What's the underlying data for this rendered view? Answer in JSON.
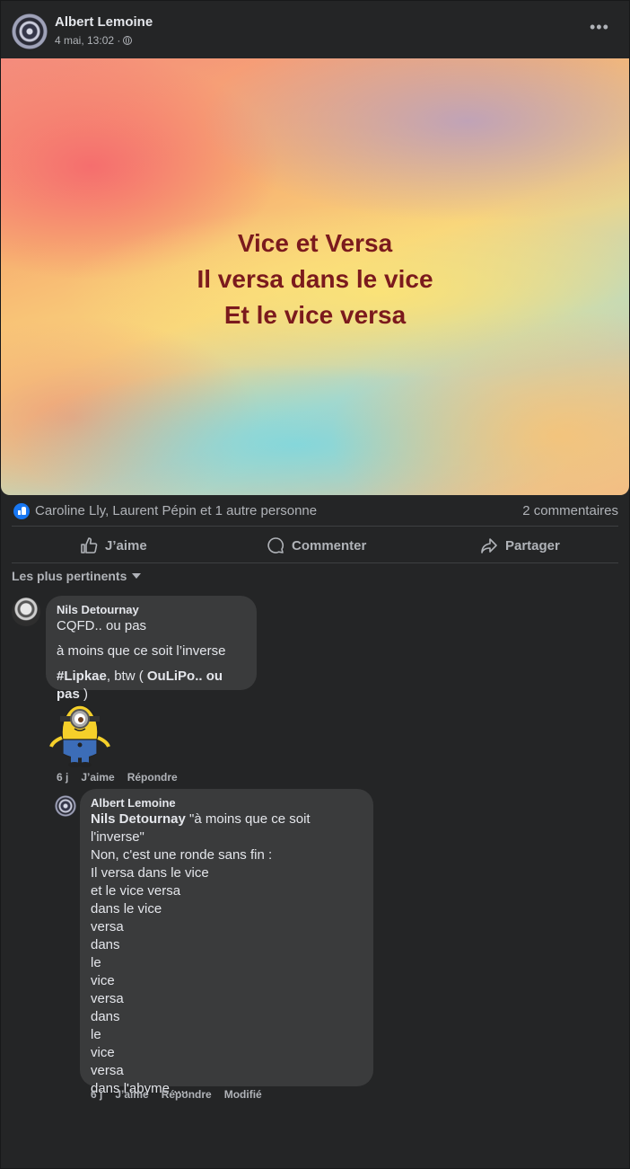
{
  "post": {
    "author": "Albert Lemoine",
    "timestamp": "4 mai, 13:02 ·",
    "more_label": "•••",
    "image_text": [
      "Vice et Versa",
      "Il versa dans le vice",
      "Et le vice versa"
    ]
  },
  "reactions": {
    "names": "Caroline Lly, Laurent Pépin et 1 autre personne",
    "comment_count": "2 commentaires"
  },
  "actions": {
    "like": "J’aime",
    "comment": "Commenter",
    "share": "Partager"
  },
  "sort_label": "Les plus pertinents",
  "comments": [
    {
      "author": "Nils Detournay",
      "line1": "CQFD.. ou pas",
      "line2": "à moins que ce soit l’inverse",
      "line3_tag": "#Lipkae",
      "line3_mid": ", btw ( ",
      "line3_bold": "OuLiPo.. ou pas",
      "line3_end": " )",
      "age": "6 j",
      "like": "J’aime",
      "reply": "Répondre"
    },
    {
      "author": "Albert Lemoine",
      "mention": "Nils Detournay",
      "quote": " \"à moins que ce soit l'inverse\"",
      "lines": [
        "Non, c'est une ronde sans fin :",
        "Il versa dans le vice",
        "et le vice versa",
        "dans le vice",
        "versa",
        "dans",
        "le",
        "vice",
        "versa",
        "dans",
        "le",
        "vice",
        "versa",
        "dans l'abyme ...."
      ],
      "age": "6 j",
      "like": "J’aime",
      "reply": "Répondre",
      "edited": "Modifié"
    }
  ],
  "colors": {
    "background": "#242526",
    "bubble": "#3a3b3c",
    "like_blue": "#1877f2",
    "image_text": "#7b1a1d"
  }
}
